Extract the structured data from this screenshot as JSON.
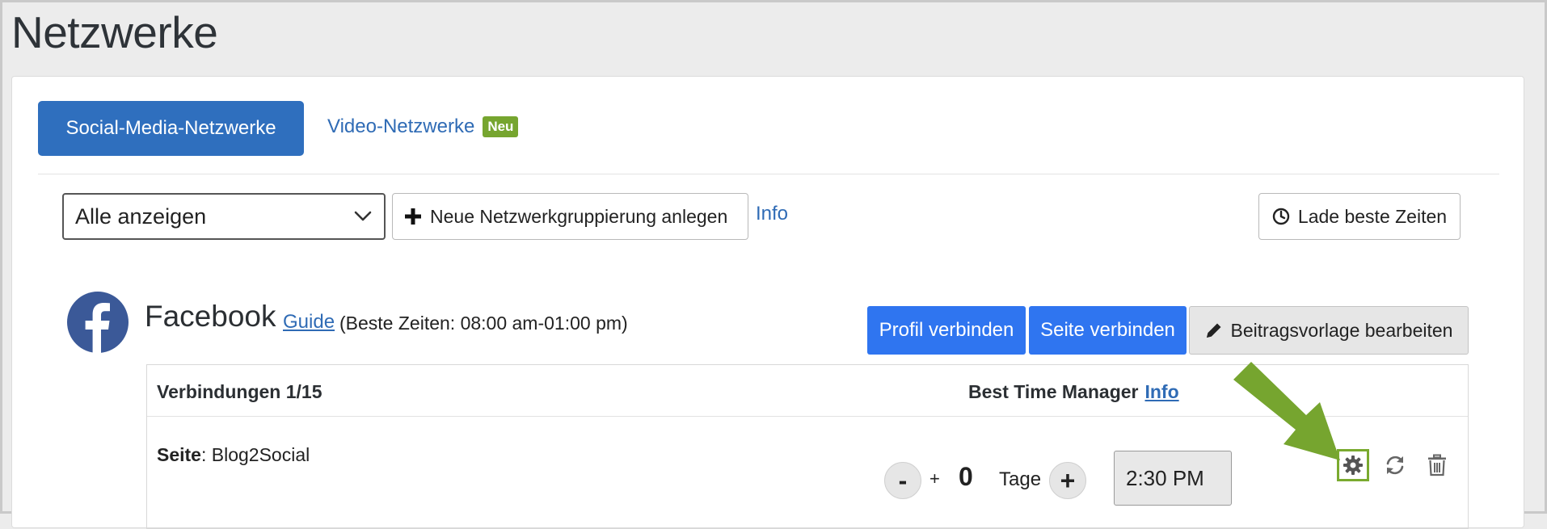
{
  "page": {
    "title": "Netzwerke"
  },
  "tabs": {
    "social": "Social-Media-Netzwerke",
    "video": "Video-Netzwerke",
    "video_badge": "Neu"
  },
  "filter": {
    "selected": "Alle anzeigen",
    "new_group_label": "Neue Netzwerkgruppierung anlegen",
    "info_label": "Info",
    "best_times_label": "Lade beste Zeiten"
  },
  "network": {
    "name": "Facebook",
    "guide_label": "Guide",
    "best_times": "(Beste Zeiten: 08:00 am-01:00 pm)",
    "btn_profile": "Profil verbinden",
    "btn_page": "Seite verbinden",
    "btn_template": "Beitragsvorlage bearbeiten"
  },
  "connections": {
    "header_left": "Verbindungen 1/15",
    "header_right": "Best Time Manager",
    "header_info": "Info",
    "row": {
      "type_label": "Seite",
      "name": ": Blog2Social",
      "minus": "-",
      "plus_small": "+",
      "days_value": "0",
      "days_label": "Tage",
      "plus": "+",
      "time": "2:30 PM"
    }
  },
  "colors": {
    "primary_blue": "#2f6fbe",
    "button_blue": "#2f75f0",
    "link_blue": "#2f6bb5",
    "badge_green": "#76a52f",
    "highlight_green": "#7aaa2f",
    "facebook_blue": "#3b5998"
  },
  "icons": {
    "select": "chevron-down-icon",
    "new_group": "plus-icon",
    "best_times": "clock-icon",
    "template": "pencil-icon",
    "settings": "gear-icon",
    "refresh": "refresh-icon",
    "delete": "trash-icon",
    "network_logo": "facebook-logo-icon",
    "annotation": "arrow-icon"
  }
}
